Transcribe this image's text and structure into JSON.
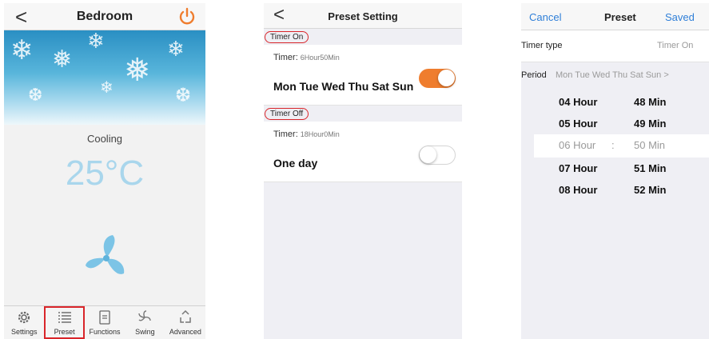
{
  "screen1": {
    "nav": {
      "back": "<",
      "title": "Bedroom",
      "power_icon": "power-icon"
    },
    "colors": {
      "accent": "#ef7d2e",
      "temp": "#a9d6ec",
      "highlight": "#d9252a"
    },
    "mode": "Cooling",
    "temperature": "25°C",
    "tabs": [
      {
        "label": "Settings",
        "icon": "gear-icon",
        "selected": false
      },
      {
        "label": "Preset",
        "icon": "list-icon",
        "selected": true
      },
      {
        "label": "Functions",
        "icon": "document-icon",
        "selected": false
      },
      {
        "label": "Swing",
        "icon": "swing-icon",
        "selected": false
      },
      {
        "label": "Advanced",
        "icon": "recycle-icon",
        "selected": false
      }
    ]
  },
  "screen2": {
    "nav": {
      "back": "<",
      "title": "Preset Setting"
    },
    "timer_on": {
      "section_label": "Timer On",
      "timer_label": "Timer:",
      "timer_value": "6Hour50Min",
      "days": "Mon Tue Wed Thu Sat Sun",
      "enabled": true
    },
    "timer_off": {
      "section_label": "Timer Off",
      "timer_label": "Timer:",
      "timer_value": "18Hour0Min",
      "days": "One day",
      "enabled": false
    }
  },
  "screen3": {
    "nav": {
      "cancel": "Cancel",
      "title": "Preset",
      "saved": "Saved"
    },
    "timer_type": {
      "label": "Timer type",
      "value": "Timer On"
    },
    "period": {
      "label": "Period",
      "value": "Mon Tue Wed Thu Sat Sun >"
    },
    "picker": {
      "rows": [
        {
          "hour": "04 Hour",
          "min": "48 Min"
        },
        {
          "hour": "05 Hour",
          "min": "49 Min"
        },
        {
          "hour": "06 Hour",
          "min": "50 Min",
          "selected": true
        },
        {
          "hour": "07 Hour",
          "min": "51 Min"
        },
        {
          "hour": "08 Hour",
          "min": "52 Min"
        }
      ],
      "separator": ":"
    }
  }
}
